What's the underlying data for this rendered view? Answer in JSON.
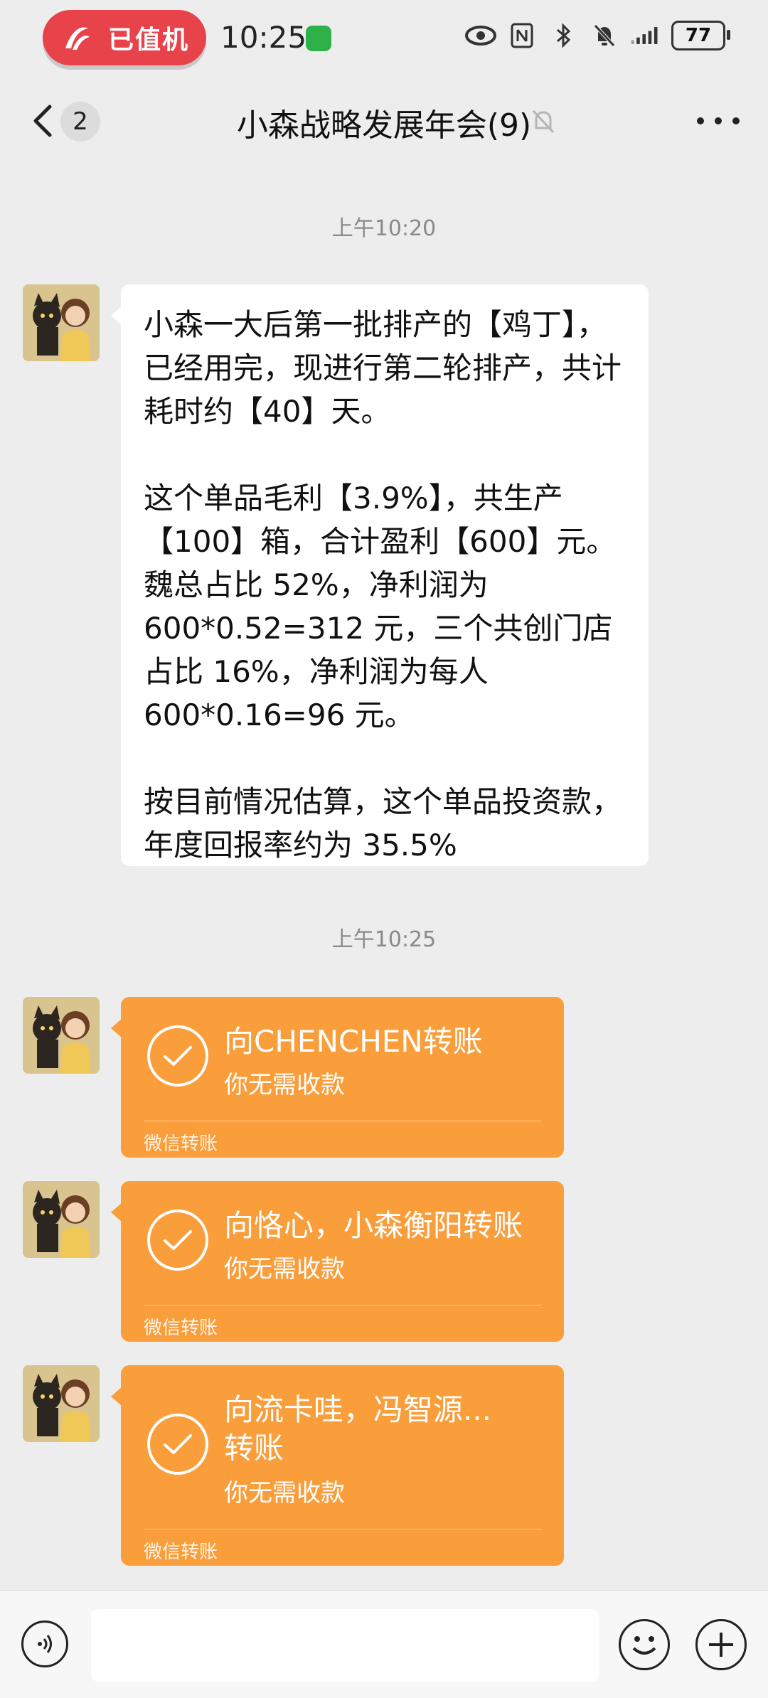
{
  "status_bar": {
    "flight_label": "已值机",
    "time": "10:25",
    "battery": "77"
  },
  "header": {
    "unread_count": "2",
    "title": "小森战略发展年会(9)"
  },
  "messages": {
    "time1": "上午10:20",
    "text_paragraphs": [
      "小森一大后第一批排产的【鸡丁】，已经用完，现进行第二轮排产，共计耗时约【40】天。",
      "这个单品毛利【3.9%】，共生产【100】箱，合计盈利【600】元。魏总占比 52%，净利润为 600*0.52=312 元，三个共创门店占比 16%，净利润为每人 600*0.16=96 元。",
      "按目前情况估算，这个单品投资款，年度回报率约为 35.5%"
    ],
    "time2": "上午10:25",
    "transfers": [
      {
        "title": "向CHENCHEN转账",
        "subtitle": "你无需收款",
        "footer": "微信转账"
      },
      {
        "title": "向恪心，小森衡阳转账",
        "subtitle": "你无需收款",
        "footer": "微信转账"
      },
      {
        "title": "向流卡哇，冯智源...转账",
        "subtitle": "你无需收款",
        "footer": "微信转账"
      }
    ]
  }
}
